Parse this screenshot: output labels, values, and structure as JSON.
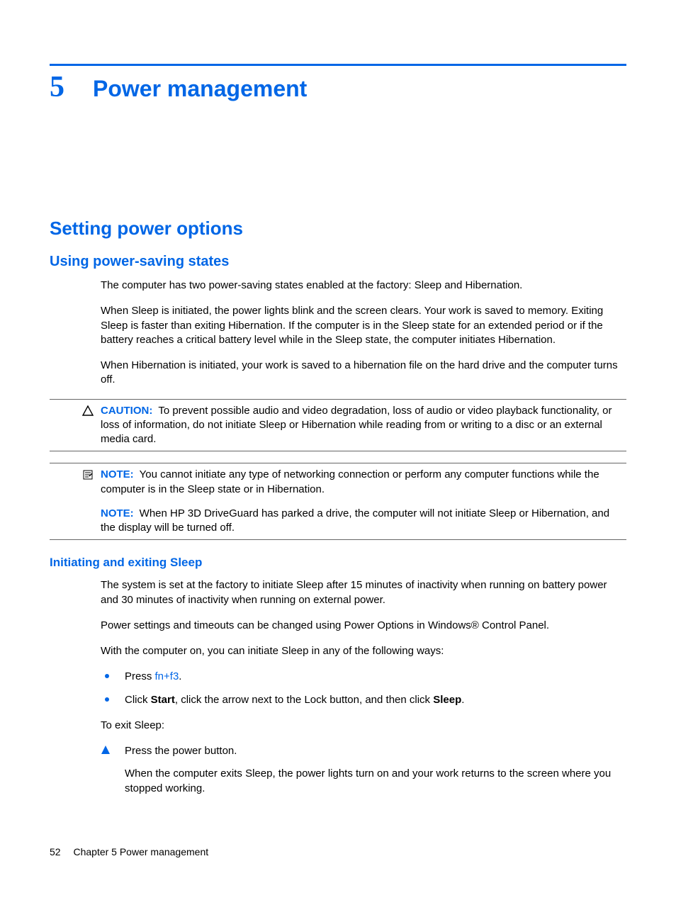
{
  "chapter": {
    "number": "5",
    "title": "Power management"
  },
  "section": {
    "title": "Setting power options"
  },
  "subsection": {
    "title": "Using power-saving states",
    "p1": "The computer has two power-saving states enabled at the factory: Sleep and Hibernation.",
    "p2": "When Sleep is initiated, the power lights blink and the screen clears. Your work is saved to memory. Exiting Sleep is faster than exiting Hibernation. If the computer is in the Sleep state for an extended period or if the battery reaches a critical battery level while in the Sleep state, the computer initiates Hibernation.",
    "p3": "When Hibernation is initiated, your work is saved to a hibernation file on the hard drive and the computer turns off."
  },
  "caution": {
    "label": "CAUTION:",
    "text": "To prevent possible audio and video degradation, loss of audio or video playback functionality, or loss of information, do not initiate Sleep or Hibernation while reading from or writing to a disc or an external media card."
  },
  "note1": {
    "label": "NOTE:",
    "text": "You cannot initiate any type of networking connection or perform any computer functions while the computer is in the Sleep state or in Hibernation."
  },
  "note2": {
    "label": "NOTE:",
    "text": "When HP 3D DriveGuard has parked a drive, the computer will not initiate Sleep or Hibernation, and the display will be turned off."
  },
  "subsub": {
    "title": "Initiating and exiting Sleep",
    "p1": "The system is set at the factory to initiate Sleep after 15 minutes of inactivity when running on battery power and 30 minutes of inactivity when running on external power.",
    "p2": "Power settings and timeouts can be changed using Power Options in Windows® Control Panel.",
    "p3": "With the computer on, you can initiate Sleep in any of the following ways:",
    "bullets": {
      "b1_pre": "Press ",
      "b1_link": "fn+f3",
      "b1_post": ".",
      "b2_pre": "Click ",
      "b2_bold1": "Start",
      "b2_mid": ", click the arrow next to the Lock button, and then click ",
      "b2_bold2": "Sleep",
      "b2_post": "."
    },
    "p4": "To exit Sleep:",
    "step1": "Press the power button.",
    "step1_after": "When the computer exits Sleep, the power lights turn on and your work returns to the screen where you stopped working."
  },
  "footer": {
    "page": "52",
    "label": "Chapter 5   Power management"
  }
}
